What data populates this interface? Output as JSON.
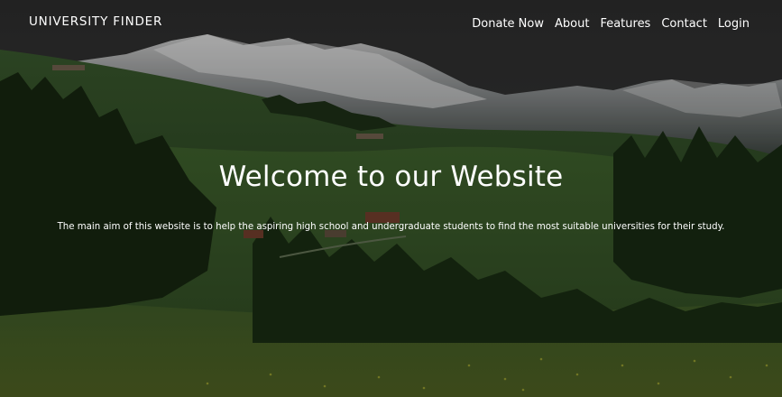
{
  "navbar": {
    "brand": "UNIVERSITY FINDER",
    "links": [
      {
        "label": "Donate Now"
      },
      {
        "label": "About"
      },
      {
        "label": "Features"
      },
      {
        "label": "Contact"
      },
      {
        "label": "Login"
      }
    ]
  },
  "hero": {
    "title": "Welcome to our Website",
    "description": "The main aim of this website is to help the aspiring high school and undergraduate students to find the most suitable universities for their study."
  },
  "colors": {
    "text": "#ffffff",
    "sky": "#333333",
    "mountains": "#9a9a9a",
    "hills": "#2f4a22"
  }
}
